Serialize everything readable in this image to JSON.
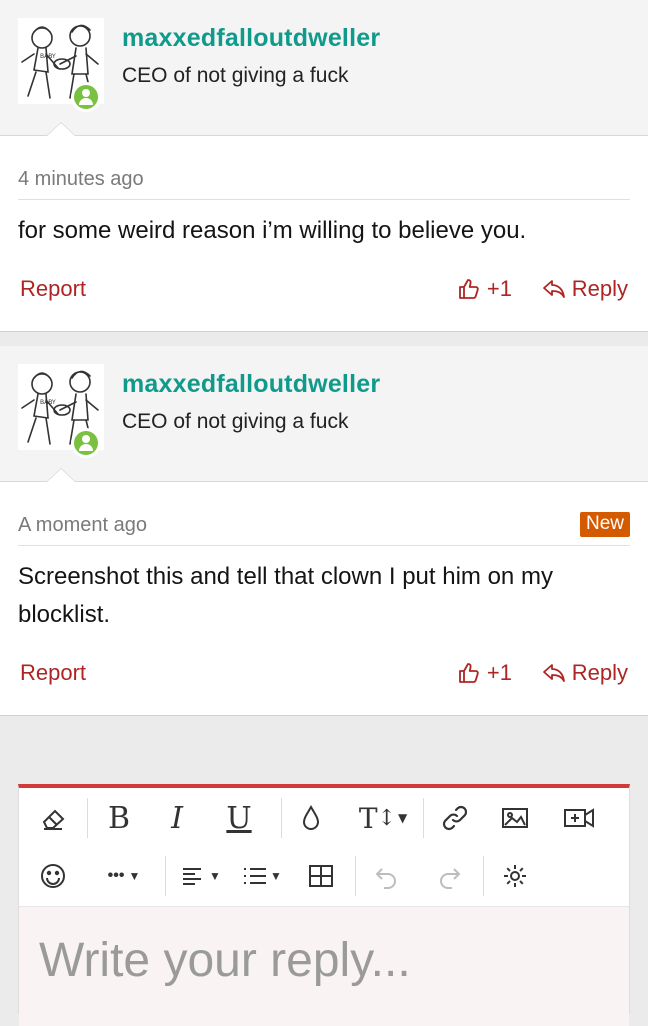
{
  "posts": [
    {
      "username": "maxxedfalloutdweller",
      "user_title": "CEO of not giving a fuck",
      "timestamp": "4 minutes ago",
      "badge": "",
      "message": "for some weird reason i’m willing to believe you.",
      "report_label": "Report",
      "like_count": "+1",
      "reply_label": "Reply"
    },
    {
      "username": "maxxedfalloutdweller",
      "user_title": "CEO of not giving a fuck",
      "timestamp": "A moment ago",
      "badge": "New",
      "message": "Screenshot this and tell that clown I put him on my blocklist.",
      "report_label": "Report",
      "like_count": "+1",
      "reply_label": "Reply"
    }
  ],
  "editor": {
    "placeholder": "Write your reply...",
    "toolbar_row1": [
      "eraser-icon",
      "bold-icon",
      "italic-icon",
      "underline-icon",
      "color-drop-icon",
      "text-size-icon",
      "link-icon",
      "image-icon",
      "video-icon"
    ],
    "toolbar_row2": [
      "smiley-icon",
      "more-icon",
      "align-icon",
      "list-icon",
      "table-icon",
      "undo-icon",
      "redo-icon",
      "settings-icon"
    ],
    "toolbar_glyphs": {
      "bold": "B",
      "italic": "I",
      "underline": "U",
      "text_size": "T",
      "more": "•••"
    }
  },
  "colors": {
    "username": "#0f9a8b",
    "action_red": "#ae2525",
    "badge_new": "#d45a00",
    "online": "#7ac142",
    "editor_border": "#d23a3a"
  }
}
